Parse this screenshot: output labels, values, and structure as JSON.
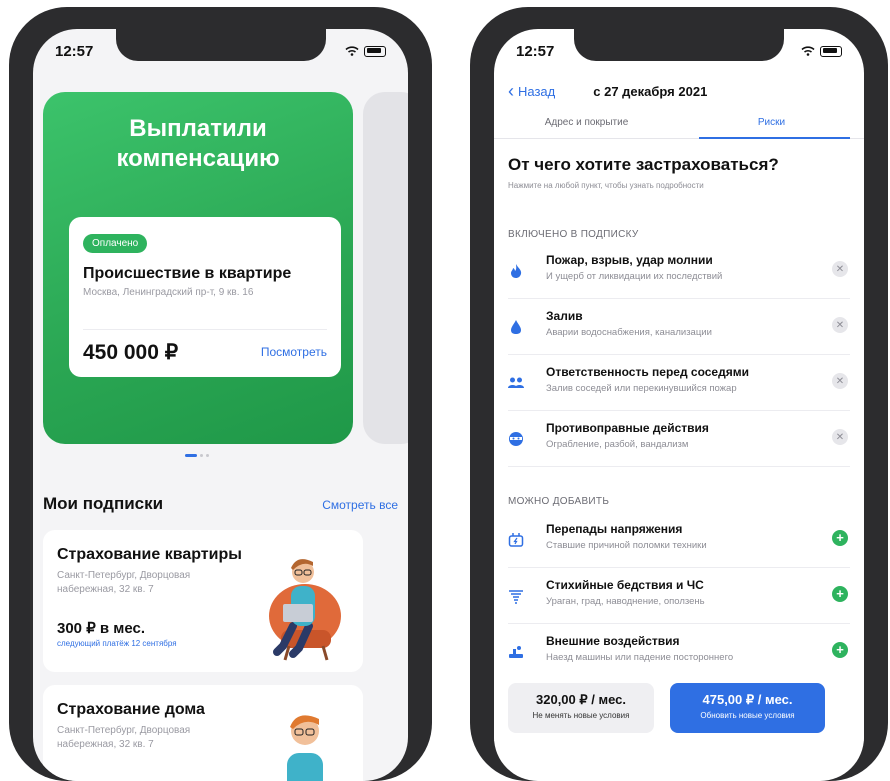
{
  "status": {
    "time_left": "12:57",
    "time_right": "12:57"
  },
  "left": {
    "promo": {
      "title_line1": "Выплатили",
      "title_line2": "компенсацию",
      "badge": "Оплачено",
      "claim_title": "Происшествие в квартире",
      "claim_address": "Москва, Ленинградский пр-т, 9 кв. 16",
      "amount": "450 000 ₽",
      "link": "Посмотреть"
    },
    "subscriptions": {
      "title": "Мои подписки",
      "see_all": "Смотреть все",
      "items": [
        {
          "title": "Страхование квартиры",
          "address_line1": "Санкт-Петербург, Дворцовая",
          "address_line2": "набережная, 32 кв. 7",
          "price": "300 ₽ в мес.",
          "next_payment": "следующий платёж 12 сентября"
        },
        {
          "title": "Страхование дома",
          "address_line1": "Санкт-Петербург, Дворцовая",
          "address_line2": "набережная, 32 кв. 7"
        }
      ]
    }
  },
  "right": {
    "nav": {
      "back": "Назад",
      "title": "с 27 декабря 2021"
    },
    "tabs": [
      {
        "label": "Адрес и покрытие",
        "active": false
      },
      {
        "label": "Риски",
        "active": true
      }
    ],
    "heading": "От чего хотите застраховаться?",
    "subheading": "Нажмите на любой пункт, чтобы узнать подробности",
    "included_label": "ВКЛЮЧЕНО В ПОДПИСКУ",
    "included": [
      {
        "title": "Пожар, взрыв, удар молнии",
        "desc": "И ущерб от ликвидации их последствий",
        "icon": "fire-icon"
      },
      {
        "title": "Залив",
        "desc": "Аварии водоснабжения, канализации",
        "icon": "water-drop-icon"
      },
      {
        "title": "Ответственность перед соседями",
        "desc": "Залив соседей или перекинувшийся пожар",
        "icon": "neighbors-icon"
      },
      {
        "title": "Противоправные действия",
        "desc": "Ограбление, разбой, вандализм",
        "icon": "robber-icon"
      }
    ],
    "addable_label": "МОЖНО ДОБАВИТЬ",
    "addable": [
      {
        "title": "Перепады напряжения",
        "desc": "Ставшие причиной поломки техники",
        "icon": "power-surge-icon"
      },
      {
        "title": "Стихийные бедствия и ЧС",
        "desc": "Ураган, град, наводнение, оползень",
        "icon": "tornado-icon"
      },
      {
        "title": "Внешние воздействия",
        "desc": "Наезд машины или падение постороннего",
        "icon": "external-impact-icon"
      }
    ],
    "buttons": {
      "keep_price": "320,00 ₽ / мес.",
      "keep_note": "Не менять новые условия",
      "update_price": "475,00 ₽ / мес.",
      "update_note": "Обновить новые условия"
    }
  },
  "colors": {
    "accent": "#2f6fe3",
    "green": "#2eb35e",
    "phone_frame": "#2c2c2e"
  }
}
